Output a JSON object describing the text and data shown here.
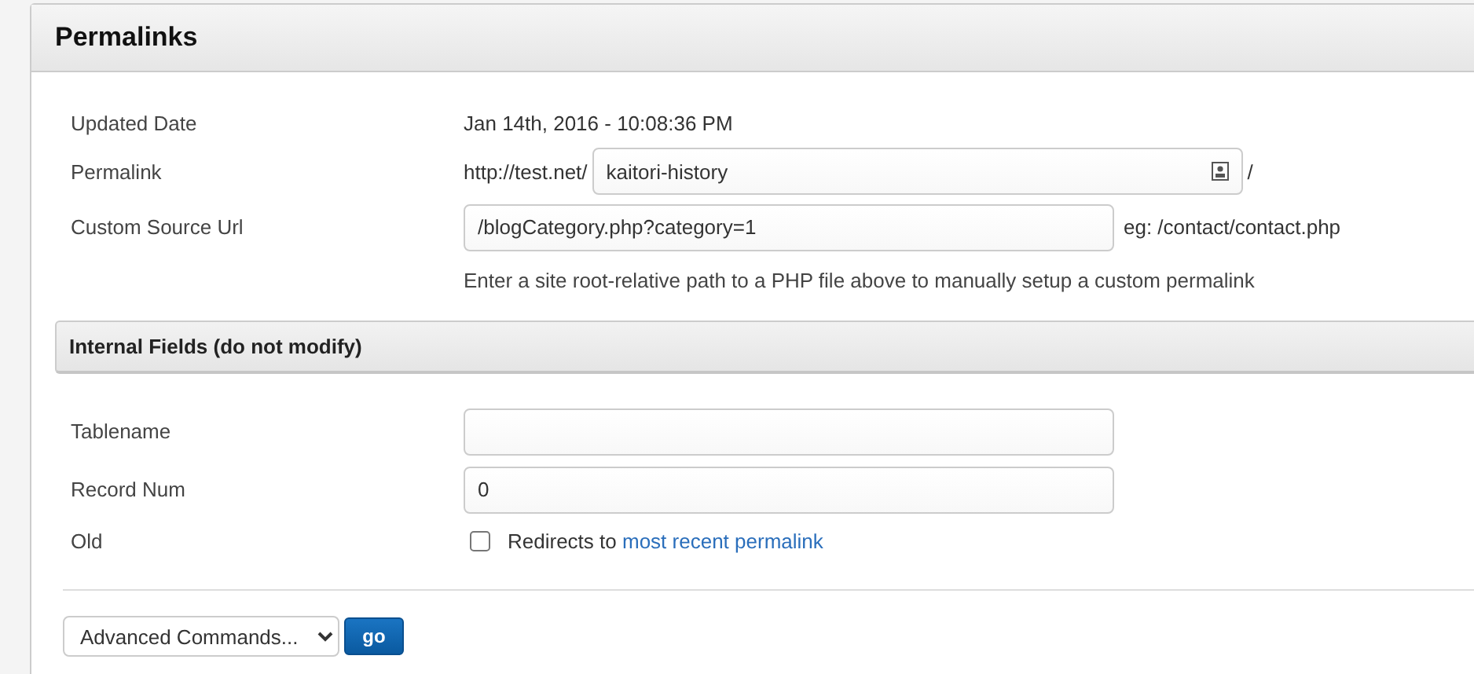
{
  "panel": {
    "title": "Permalinks"
  },
  "permalink_fields": [
    {
      "kind": "text",
      "label": "Updated Date",
      "value": "Jan 14th, 2016 - 10:08:36 PM"
    },
    {
      "kind": "permalink",
      "label": "Permalink",
      "prefix": "http://test.net/",
      "value": "kaitori-history",
      "suffix": "/"
    },
    {
      "kind": "input",
      "label": "Custom Source Url",
      "value": "/blogCategory.php?category=1",
      "note": "eg: /contact/contact.php",
      "help": "Enter a site root-relative path to a PHP file above to manually setup a custom permalink"
    }
  ],
  "internal_section": {
    "title": "Internal Fields (do not modify)"
  },
  "internal_fields": [
    {
      "kind": "input",
      "label": "Tablename"
    },
    {
      "kind": "input",
      "label": "Record Num",
      "value": "0"
    },
    {
      "kind": "checkbox",
      "label": "Old",
      "checked": false,
      "text": "Redirects to",
      "link": "most recent permalink"
    }
  ],
  "commands": {
    "select": "Advanced Commands...",
    "button": "go"
  }
}
